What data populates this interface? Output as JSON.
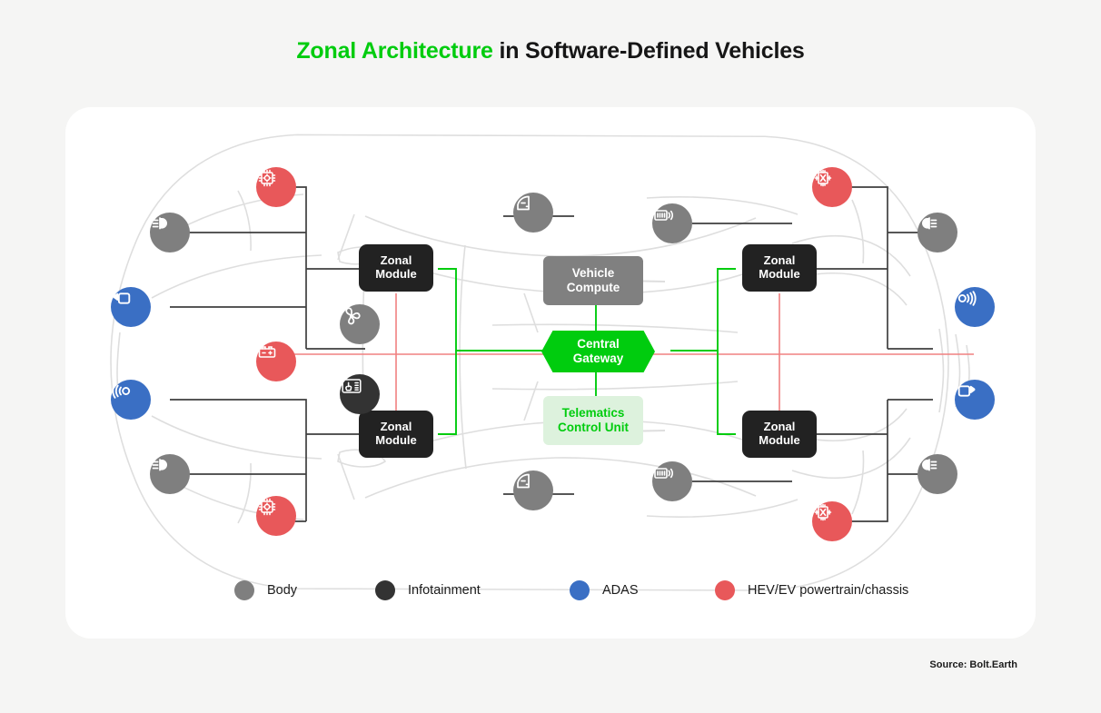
{
  "title": {
    "accent": "Zonal Architecture",
    "rest": " in Software-Defined Vehicles"
  },
  "source": "Source: Bolt.Earth",
  "colors": {
    "background": "#f5f5f4",
    "card": "#ffffff",
    "green": "#00cc0e",
    "green_light": "#ddf2dd",
    "body_gray": "#7f7f7f",
    "infotainment_dark": "#333333",
    "adas_blue": "#3a6fc4",
    "hev_red": "#e8585a",
    "zonal_module_bg": "#222222",
    "vehicle_compute_bg": "#808080",
    "bus_line": "#3f3f3f",
    "power_line": "#f08080",
    "data_line": "#00cc0e",
    "car_outline": "#dcdcdc"
  },
  "central": {
    "vehicle_compute": "Vehicle\nCompute",
    "central_gateway": "Central\nGateway",
    "telematics_control_unit": "Telematics\nControl Unit"
  },
  "zonal_modules": [
    {
      "id": "front-left",
      "label": "Zonal\nModule"
    },
    {
      "id": "rear-left",
      "label": "Zonal\nModule"
    },
    {
      "id": "front-right",
      "label": "Zonal\nModule"
    },
    {
      "id": "rear-right",
      "label": "Zonal\nModule"
    }
  ],
  "icon_nodes": [
    {
      "id": "ecu-front-left",
      "icon": "chip-icon",
      "category": "HEV/EV powertrain/chassis",
      "color": "#e8585a"
    },
    {
      "id": "headlight-front-left",
      "icon": "headlight-icon",
      "category": "Body",
      "color": "#7f7f7f"
    },
    {
      "id": "camera-front-left",
      "icon": "camera-icon",
      "category": "ADAS",
      "color": "#3a6fc4"
    },
    {
      "id": "battery-left",
      "icon": "battery-icon",
      "category": "HEV/EV powertrain/chassis",
      "color": "#e8585a"
    },
    {
      "id": "radar-rear-left",
      "icon": "radar-icon",
      "category": "ADAS",
      "color": "#3a6fc4"
    },
    {
      "id": "headlight-rear-left",
      "icon": "headlight-icon",
      "category": "Body",
      "color": "#7f7f7f"
    },
    {
      "id": "ecu-rear-left",
      "icon": "chip-icon",
      "category": "HEV/EV powertrain/chassis",
      "color": "#e8585a"
    },
    {
      "id": "door-front",
      "icon": "car-door-icon",
      "category": "Body",
      "color": "#7f7f7f"
    },
    {
      "id": "keyfob-front",
      "icon": "keyless-entry-icon",
      "category": "Body",
      "color": "#7f7f7f"
    },
    {
      "id": "hvac-fan",
      "icon": "fan-icon",
      "category": "Body",
      "color": "#7f7f7f"
    },
    {
      "id": "touchscreen",
      "icon": "touchscreen-icon",
      "category": "Infotainment",
      "color": "#333333"
    },
    {
      "id": "door-rear",
      "icon": "car-door-icon",
      "category": "Body",
      "color": "#7f7f7f"
    },
    {
      "id": "keyfob-rear",
      "icon": "keyless-entry-icon",
      "category": "Body",
      "color": "#7f7f7f"
    },
    {
      "id": "inverter-front-right",
      "icon": "inverter-icon",
      "category": "HEV/EV powertrain/chassis",
      "color": "#e8585a"
    },
    {
      "id": "headlight-front-right",
      "icon": "headlight-icon",
      "category": "Body",
      "color": "#7f7f7f"
    },
    {
      "id": "radar-front-right",
      "icon": "radar-icon",
      "category": "ADAS",
      "color": "#3a6fc4"
    },
    {
      "id": "camera-rear-right",
      "icon": "camera-icon",
      "category": "ADAS",
      "color": "#3a6fc4"
    },
    {
      "id": "headlight-rear-right",
      "icon": "headlight-icon",
      "category": "Body",
      "color": "#7f7f7f"
    },
    {
      "id": "inverter-rear-right",
      "icon": "inverter-icon",
      "category": "HEV/EV powertrain/chassis",
      "color": "#e8585a"
    }
  ],
  "legend": [
    {
      "label": "Body",
      "color": "#7f7f7f"
    },
    {
      "label": "Infotainment",
      "color": "#333333"
    },
    {
      "label": "ADAS",
      "color": "#3a6fc4"
    },
    {
      "label": "HEV/EV powertrain/chassis",
      "color": "#e8585a"
    }
  ]
}
